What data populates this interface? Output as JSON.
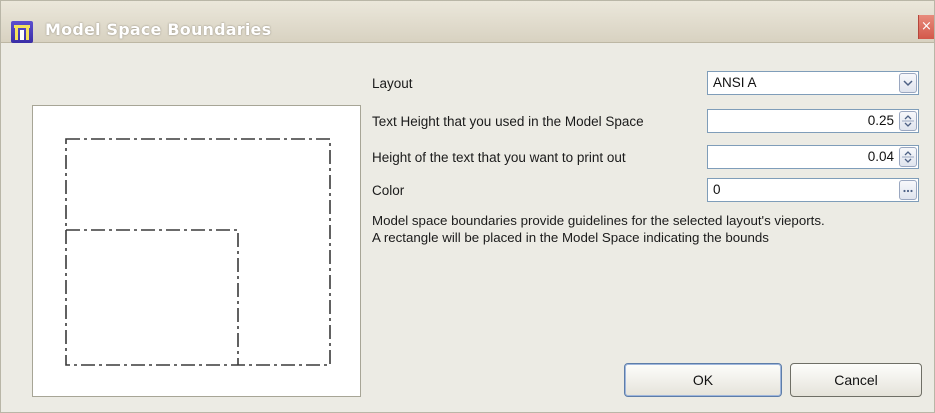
{
  "window": {
    "title": "Model Space Boundaries",
    "close_icon": "close-icon",
    "app_icon": "app-logo-icon"
  },
  "form": {
    "layout": {
      "label": "Layout",
      "value": "ANSI A",
      "control_icon": "chevron-down-icon"
    },
    "text_height_model": {
      "label": "Text Height that you used in the Model Space",
      "value": "0.25",
      "control_icon": "spinner-icon"
    },
    "text_height_print": {
      "label": "Height of the text that you want to print out",
      "value": "0.04",
      "control_icon": "spinner-icon"
    },
    "color": {
      "label": "Color",
      "value": "0",
      "control_icon": "ellipsis-icon"
    }
  },
  "description": {
    "line1": "Model space boundaries provide guidelines for the selected layout's vieports.",
    "line2": "A rectangle will be placed in the Model Space indicating the bounds"
  },
  "buttons": {
    "ok": "OK",
    "cancel": "Cancel"
  }
}
